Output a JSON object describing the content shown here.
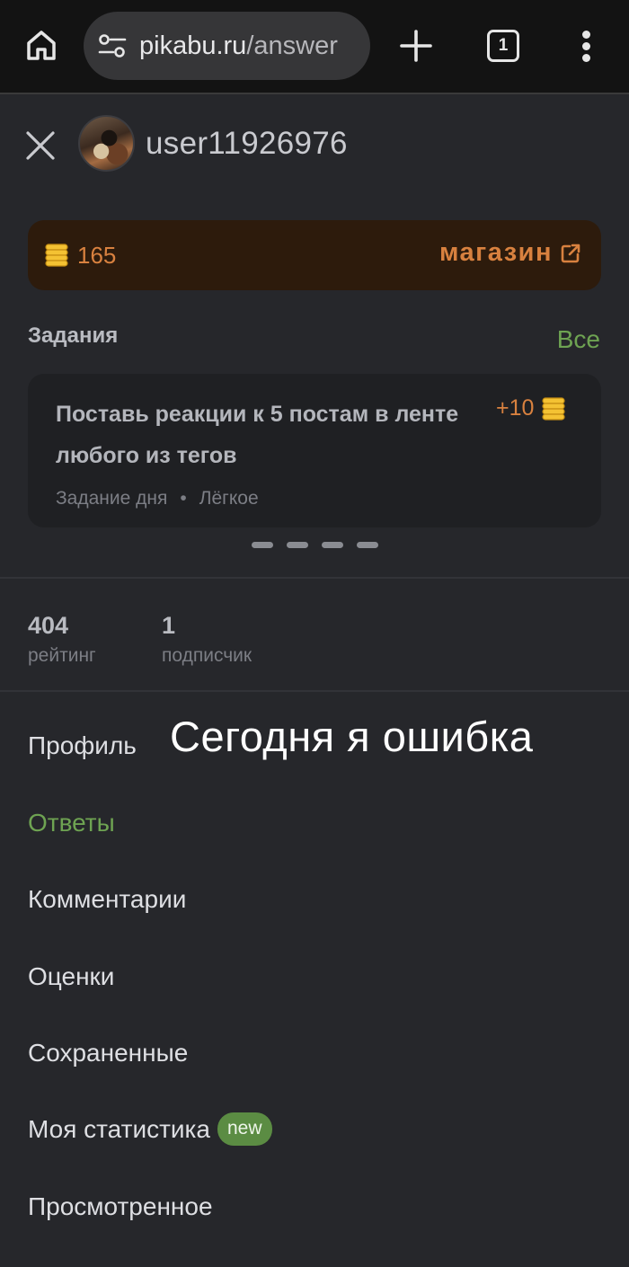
{
  "browser": {
    "url_host": "pikabu.ru",
    "url_path": "/answer",
    "tab_count": "1"
  },
  "header": {
    "username": "user11926976"
  },
  "coins": {
    "count": "165",
    "shop_label": "магазин"
  },
  "tasks": {
    "title": "Задания",
    "all_label": "Все",
    "card": {
      "text": "Поставь реакции к 5 постам в ленте любого из тегов",
      "reward": "+10",
      "type": "Задание дня",
      "separator": "•",
      "difficulty": "Лёгкое"
    },
    "pager_dots": 4
  },
  "stats": {
    "rating_value": "404",
    "rating_label": "рейтинг",
    "subscribers_value": "1",
    "subscribers_label": "подписчик"
  },
  "menu": {
    "items": [
      {
        "label": "Профиль"
      },
      {
        "label": "Ответы",
        "active": true
      },
      {
        "label": "Комментарии"
      },
      {
        "label": "Оценки"
      },
      {
        "label": "Сохраненные"
      },
      {
        "label": "Моя статистика",
        "badge": "new"
      },
      {
        "label": "Просмотренное"
      }
    ]
  },
  "overlay_caption": "Сегодня я ошибка",
  "colors": {
    "accent_green": "#6ea352",
    "coin_orange": "#d8813f",
    "background": "#26272b"
  }
}
